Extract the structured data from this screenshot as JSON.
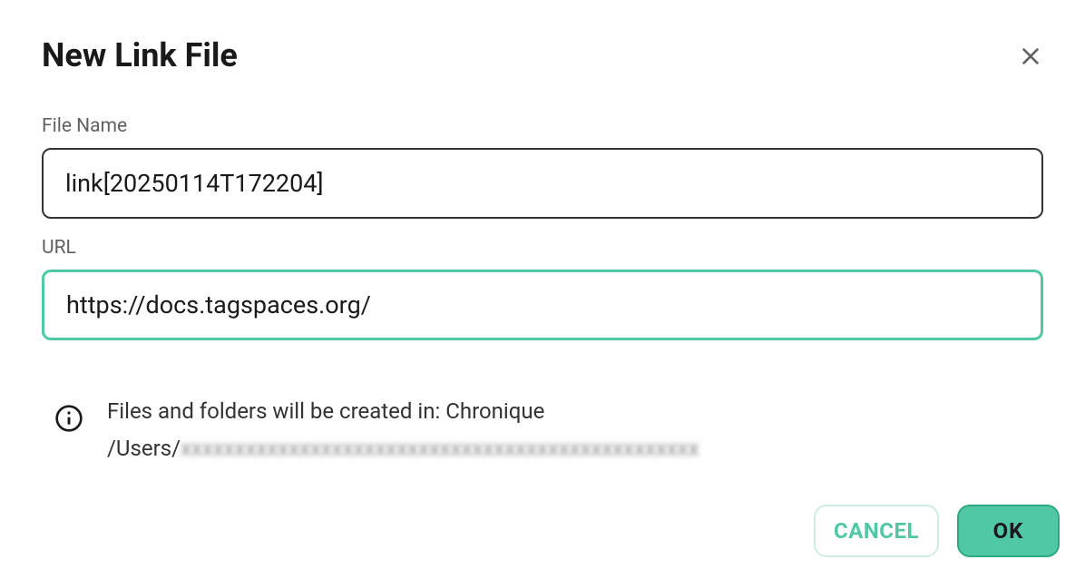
{
  "dialog": {
    "title": "New Link File",
    "fields": {
      "filename": {
        "label": "File Name",
        "value": "link[20250114T172204]"
      },
      "url": {
        "label": "URL",
        "value": "https://docs.tagspaces.org/"
      }
    },
    "info": {
      "line1": "Files and folders will be created in: Chronique",
      "line2_prefix": "/Users/",
      "line2_blurred": "xxxxxxxxxxxxxxxxxxxxxxxxxxxxxxxxxxxxxxxxxxxxxxxx"
    },
    "buttons": {
      "cancel": "CANCEL",
      "ok": "OK"
    }
  }
}
